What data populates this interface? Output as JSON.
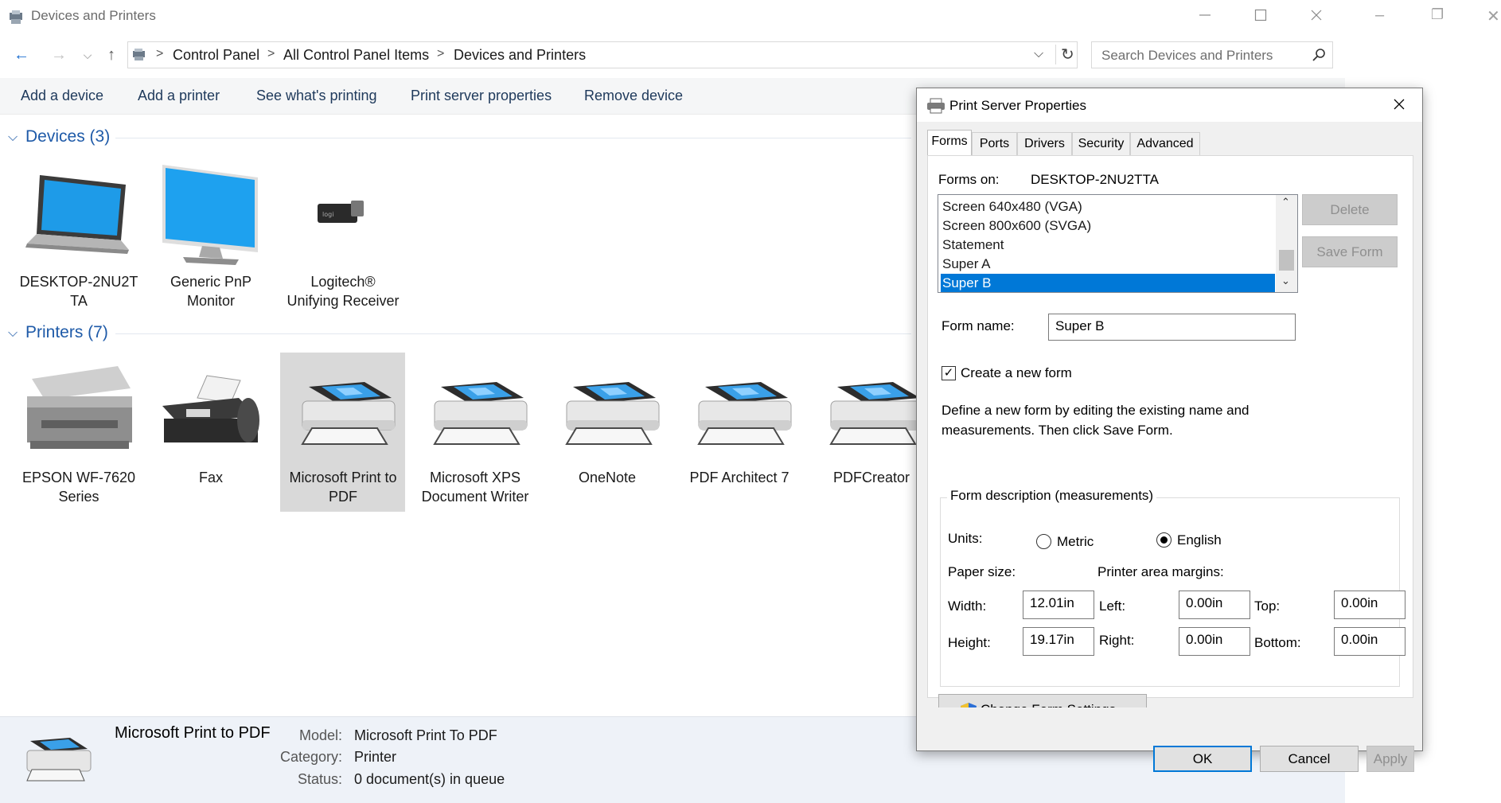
{
  "window": {
    "title": "Devices and Printers",
    "behind_controls": {
      "minimize": "–",
      "maximize": "❐",
      "close": "✕"
    }
  },
  "address": {
    "crumbs": [
      "Control Panel",
      "All Control Panel Items",
      "Devices and Printers"
    ]
  },
  "search": {
    "placeholder": "Search Devices and Printers"
  },
  "commands": [
    "Add a device",
    "Add a printer",
    "See what's printing",
    "Print server properties",
    "Remove device"
  ],
  "devices": {
    "header": "Devices (3)",
    "items": [
      {
        "label": "DESKTOP-2NU2T\nTA",
        "line1": "DESKTOP-2NU2T",
        "line2": "TA",
        "icon": "laptop-icon"
      },
      {
        "line1": "Generic PnP",
        "line2": "Monitor",
        "icon": "monitor-icon"
      },
      {
        "line1": "Logitech®",
        "line2": "Unifying Receiver",
        "icon": "usb-receiver-icon"
      }
    ]
  },
  "printers": {
    "header": "Printers (7)",
    "items": [
      {
        "line1": "EPSON WF-7620",
        "line2": "Series",
        "icon": "multifunction-printer-icon"
      },
      {
        "line1": "Fax",
        "line2": "",
        "icon": "fax-icon"
      },
      {
        "line1": "Microsoft Print to",
        "line2": "PDF",
        "icon": "printer-icon",
        "selected": true
      },
      {
        "line1": "Microsoft XPS",
        "line2": "Document Writer",
        "icon": "printer-icon"
      },
      {
        "line1": "OneNote",
        "line2": "",
        "icon": "printer-icon"
      },
      {
        "line1": "PDF Architect 7",
        "line2": "",
        "icon": "printer-icon"
      },
      {
        "line1": "PDFCreator",
        "line2": "",
        "icon": "printer-icon"
      }
    ]
  },
  "details": {
    "name": "Microsoft Print to PDF",
    "model_key": "Model:",
    "model_val": "Microsoft Print To PDF",
    "category_key": "Category:",
    "category_val": "Printer",
    "status_key": "Status:",
    "status_val": "0 document(s) in queue"
  },
  "dialog": {
    "title": "Print Server Properties",
    "tabs": [
      "Forms",
      "Ports",
      "Drivers",
      "Security",
      "Advanced"
    ],
    "active_tab": "Forms",
    "forms_on_label": "Forms on:",
    "forms_on_value": "DESKTOP-2NU2TTA",
    "list": [
      "Screen 640x480 (VGA)",
      "Screen 800x600 (SVGA)",
      "Statement",
      "Super A",
      "Super B"
    ],
    "list_selected": "Super B",
    "delete_btn": "Delete",
    "save_btn": "Save Form",
    "form_name_label": "Form name:",
    "form_name_value": "Super B",
    "create_new_label": "Create a new form",
    "create_new_checked": true,
    "help_line1": "Define a new form by editing the existing name and",
    "help_line2": "measurements. Then click Save Form.",
    "group_title": "Form description (measurements)",
    "units_label": "Units:",
    "metric_label": "Metric",
    "english_label": "English",
    "units_selected": "English",
    "paper_size_label": "Paper size:",
    "margins_label": "Printer area margins:",
    "width_label": "Width:",
    "width_value": "12.01in",
    "height_label": "Height:",
    "height_value": "19.17in",
    "left_label": "Left:",
    "left_value": "0.00in",
    "right_label": "Right:",
    "right_value": "0.00in",
    "top_label": "Top:",
    "top_value": "0.00in",
    "bottom_label": "Bottom:",
    "bottom_value": "0.00in",
    "change_btn": "Change Form Settings",
    "ok_btn": "OK",
    "cancel_btn": "Cancel",
    "apply_btn": "Apply"
  },
  "colors": {
    "accent": "#0078d7",
    "link": "#1e5aa8",
    "selection_tile": "#d9d9d9"
  }
}
